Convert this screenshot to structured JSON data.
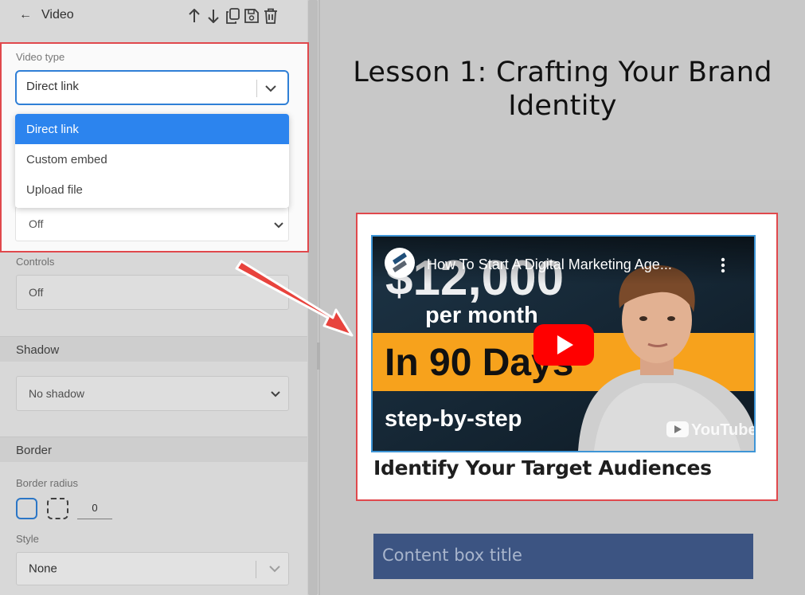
{
  "panel": {
    "title": "Video",
    "toolbar_icons": [
      "arrow-up-icon",
      "arrow-down-icon",
      "copy-icon",
      "save-icon",
      "trash-icon"
    ],
    "video_type": {
      "label": "Video type",
      "value": "Direct link",
      "options": [
        {
          "label": "Direct link",
          "selected": true
        },
        {
          "label": "Custom embed",
          "selected": false
        },
        {
          "label": "Upload file",
          "selected": false
        }
      ]
    },
    "autoplay_value": "Off",
    "controls": {
      "label": "Controls",
      "value": "Off"
    },
    "shadow": {
      "heading": "Shadow",
      "value": "No shadow"
    },
    "border": {
      "heading": "Border",
      "radius_label": "Border radius",
      "radius_value": "0",
      "style_label": "Style",
      "style_value": "None"
    }
  },
  "canvas": {
    "lesson_title": "Lesson 1: Crafting Your Brand Identity",
    "video": {
      "title": "How To Start A Digital Marketing Age...",
      "big_amount": "$12,000",
      "per_month": "per month",
      "banner": "In 90 Days",
      "footer": "step-by-step",
      "brand": "YouTube"
    },
    "video_caption": "Identify Your Target Audiences",
    "content_box_title": "Content box title"
  },
  "colors": {
    "highlight": "#e0484c",
    "accent_blue": "#2c84ee",
    "banner_orange": "#f7a21c",
    "content_box": "#3c5482",
    "youtube_red": "#ff0000"
  }
}
